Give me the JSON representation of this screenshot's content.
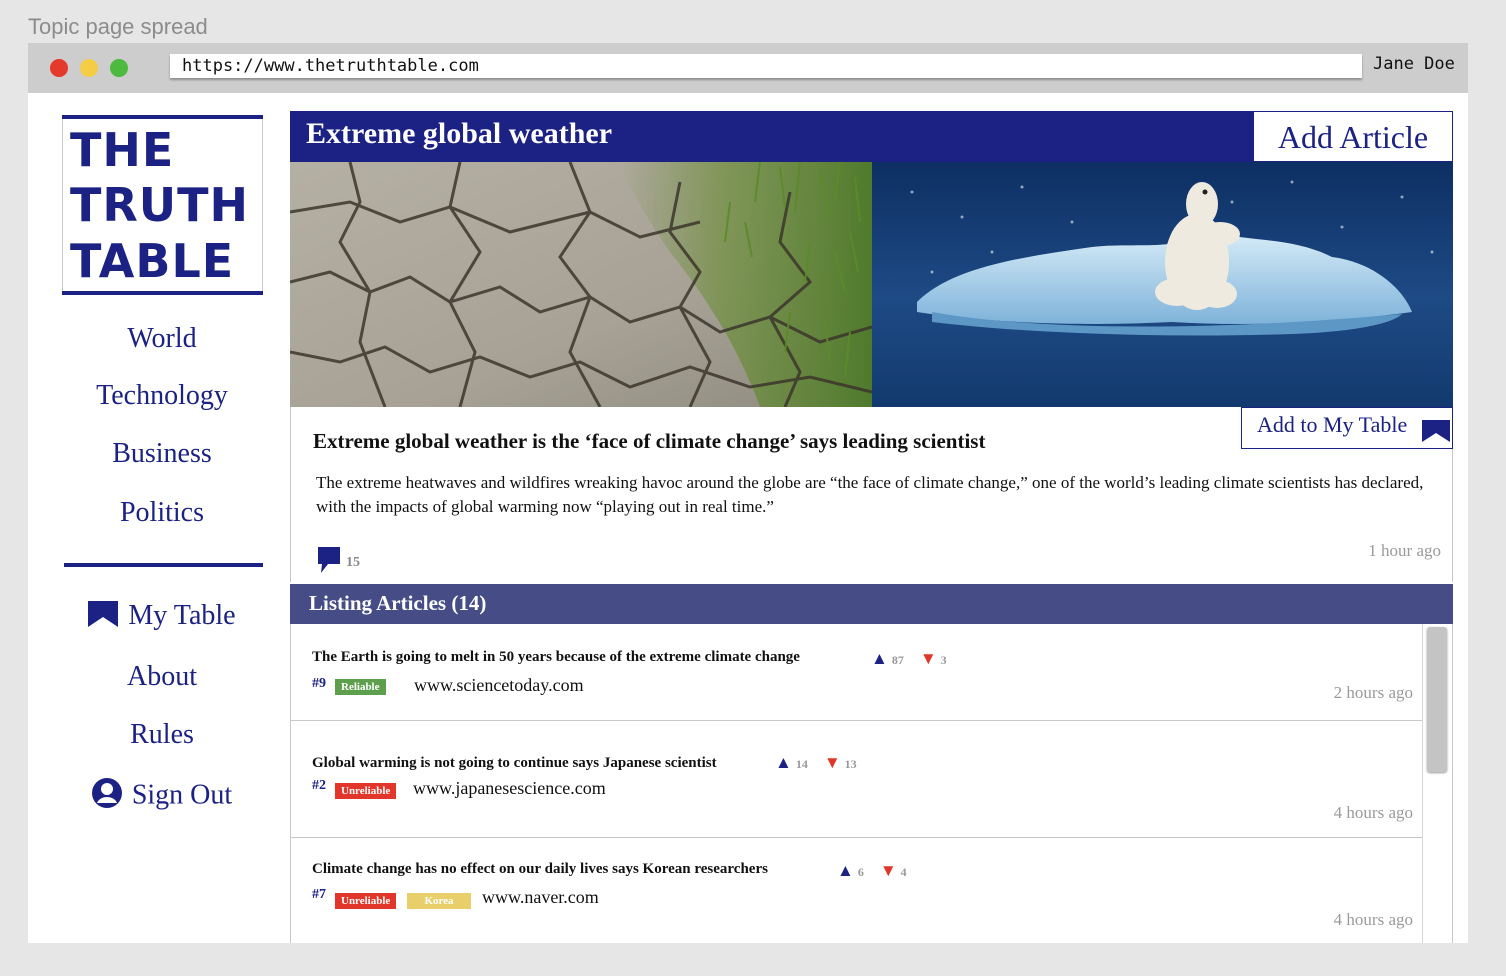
{
  "caption": "Topic page spread",
  "browser": {
    "url": "https://www.thetruthtable.com",
    "user": "Jane Doe",
    "dot_colors": [
      "#e53a2b",
      "#f2cd45",
      "#4cba3c"
    ]
  },
  "logo": {
    "line1": "THE",
    "line2": "TRUTH",
    "line3": "TABLE"
  },
  "nav": {
    "world": "World",
    "technology": "Technology",
    "business": "Business",
    "politics": "Politics",
    "my_table": "My Table",
    "about": "About",
    "rules": "Rules",
    "sign_out": "Sign Out"
  },
  "topic": {
    "title": "Extreme global weather",
    "add_article": "Add Article"
  },
  "featured": {
    "add_to_table": "Add to My Table",
    "headline": "Extreme global weather is the ‘face of climate change’ says leading scientist",
    "summary": "The extreme heatwaves and wildfires wreaking havoc around the globe are “the face of climate change,” one of the world’s leading climate scientists has declared, with the impacts of global warming now “playing out in real time.”",
    "comments": "15",
    "time": "1 hour ago"
  },
  "listing": {
    "title": "Listing Articles (14)",
    "up_arrow": "▲",
    "down_arrow": "▼",
    "articles": [
      {
        "title": "The Earth is going to melt in 50 years because of the extreme climate change",
        "up": "87",
        "down": "3",
        "rank": "#9",
        "tags": [
          {
            "label": "Reliable",
            "color": "#5e9f4e"
          }
        ],
        "source": "www.sciencetoday.com",
        "time": "2 hours ago"
      },
      {
        "title": "Global warming is not going to continue says Japanese scientist",
        "up": "14",
        "down": "13",
        "rank": "#2",
        "tags": [
          {
            "label": "Unreliable",
            "color": "#e2362a"
          }
        ],
        "source": "www.japanesescience.com",
        "time": "4 hours ago"
      },
      {
        "title": "Climate change has no effect on our daily lives says Korean researchers",
        "up": "6",
        "down": "4",
        "rank": "#7",
        "tags": [
          {
            "label": "Unreliable",
            "color": "#e2362a"
          },
          {
            "label": "Korea",
            "color": "#e9cf6b"
          }
        ],
        "source": "www.naver.com",
        "time": "4 hours ago"
      }
    ]
  }
}
